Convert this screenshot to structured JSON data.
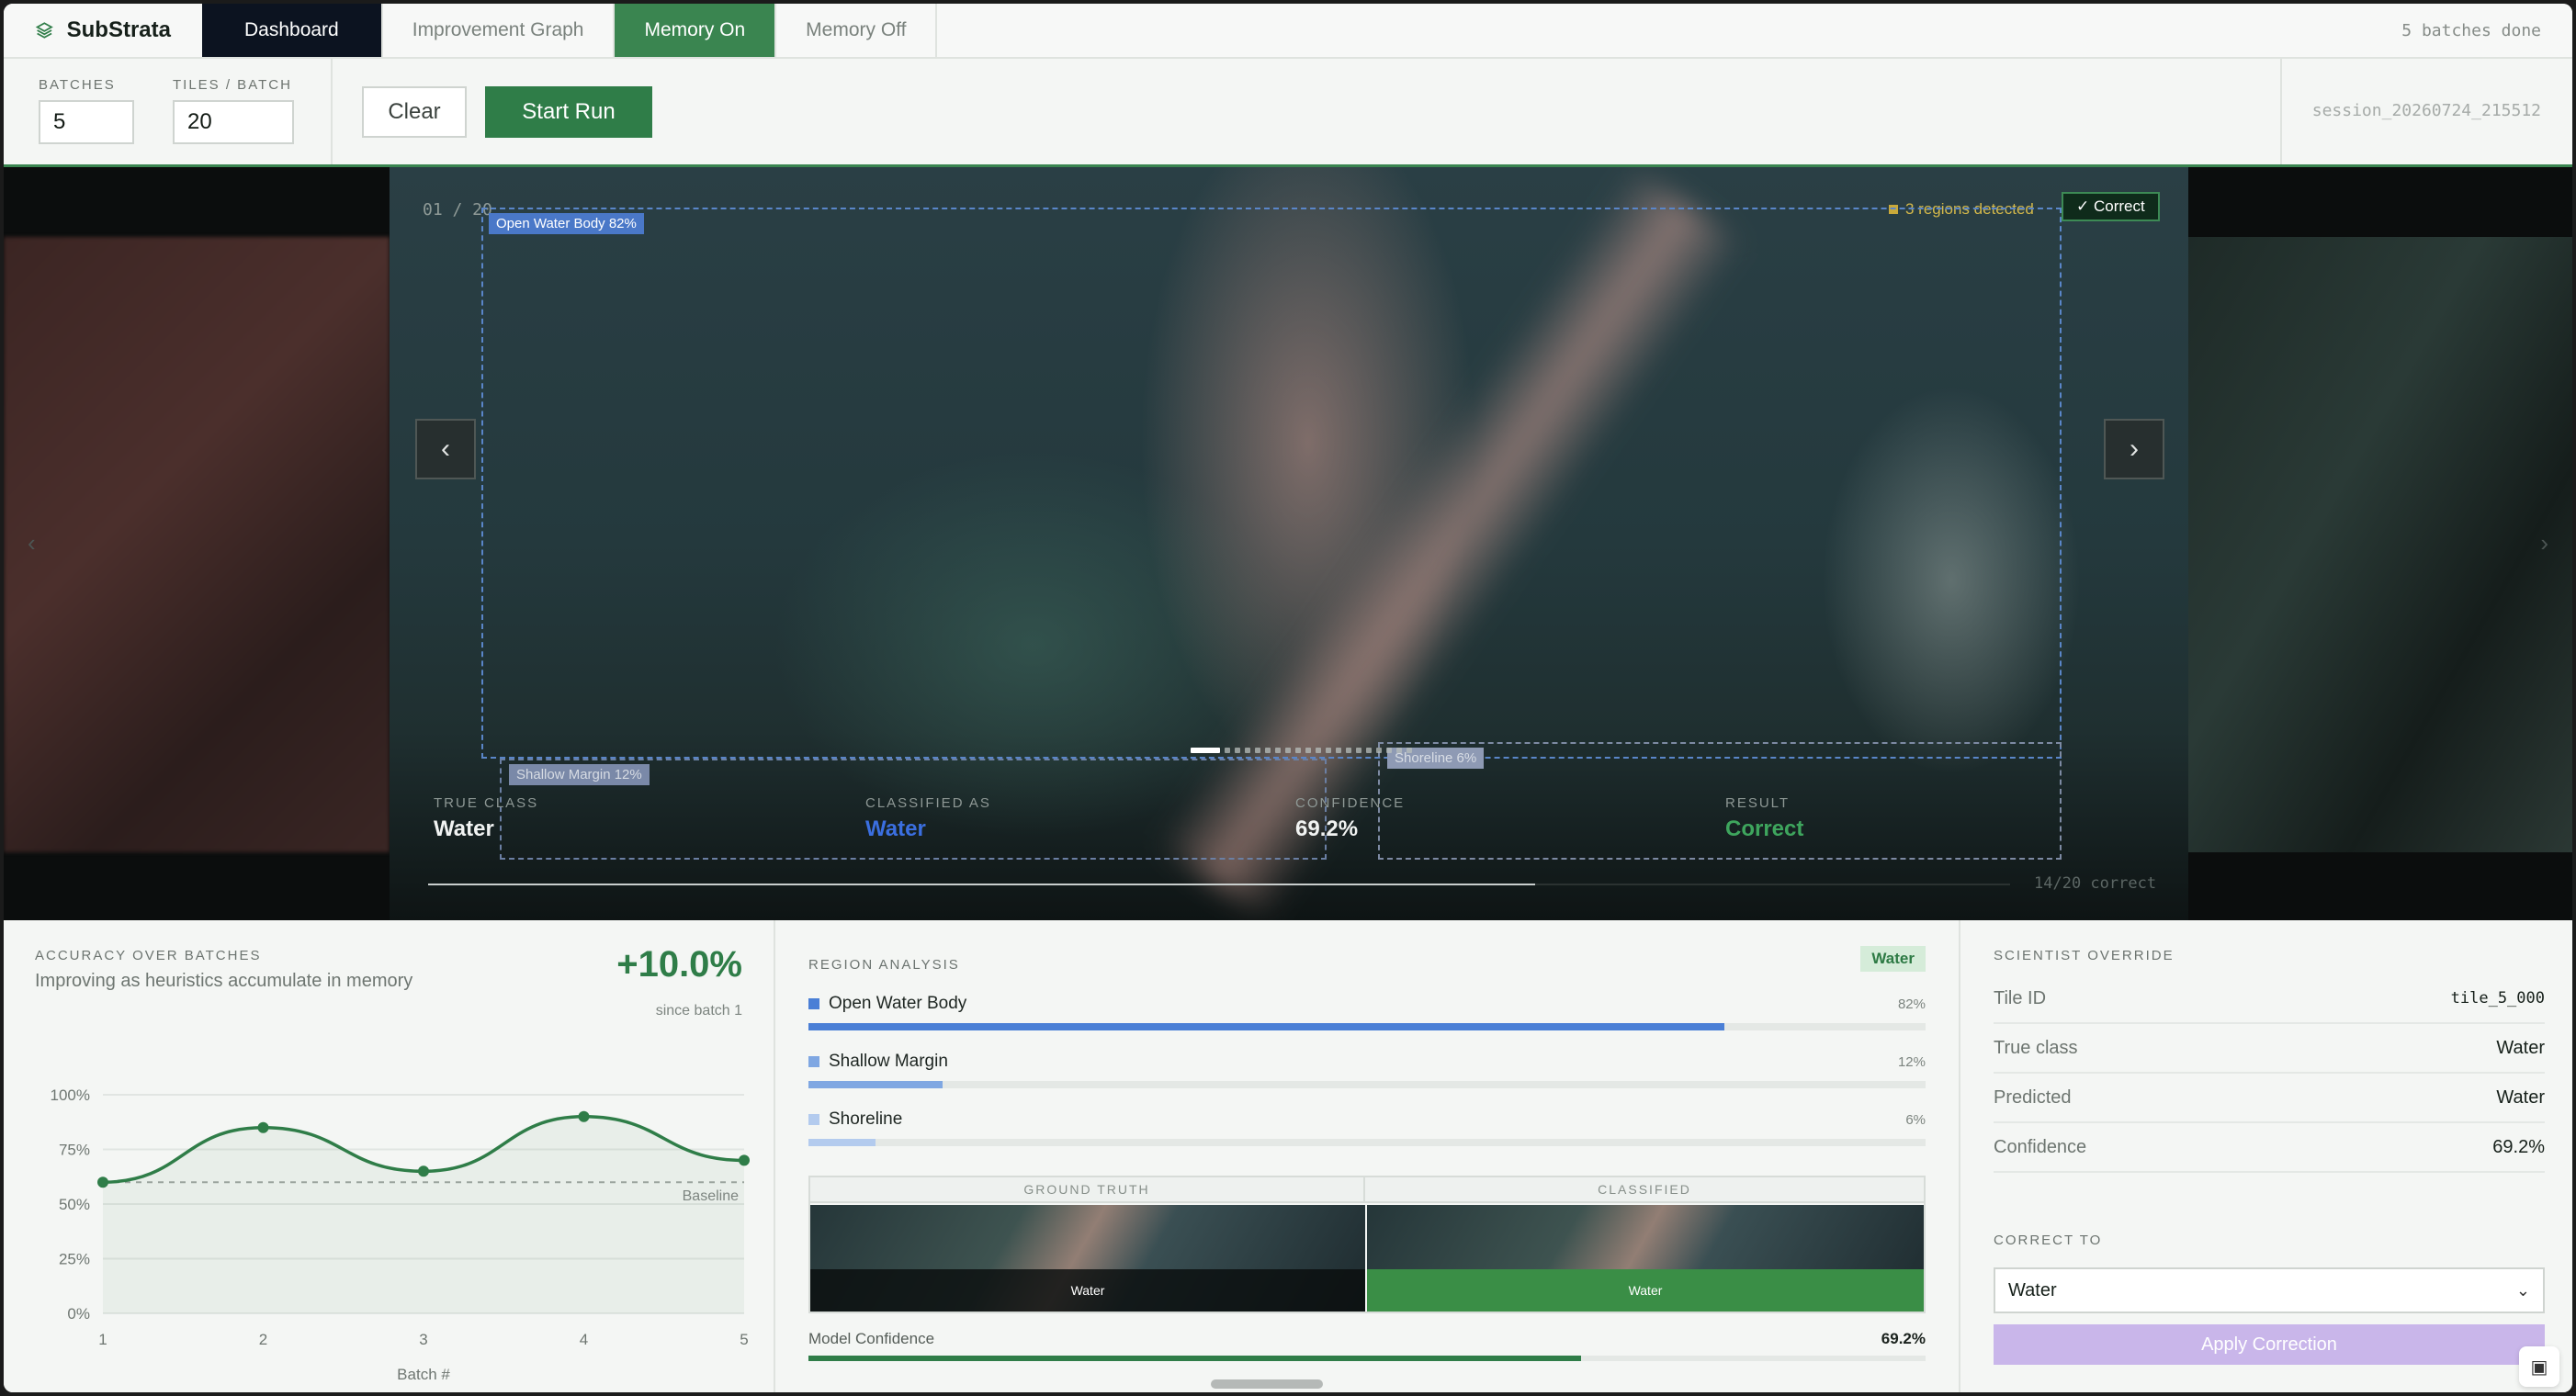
{
  "nav": {
    "brand": "SubStrata",
    "tabs": [
      "Dashboard",
      "Improvement Graph",
      "Memory On",
      "Memory Off"
    ],
    "status": "5 batches done"
  },
  "controls": {
    "batches_label": "BATCHES",
    "batches_value": "5",
    "tiles_label": "TILES / BATCH",
    "tiles_value": "20",
    "clear_label": "Clear",
    "run_label": "Start Run",
    "session": "session_20260724_215512"
  },
  "viewer": {
    "counter": "01 / 20",
    "regions_detected": "3 regions detected",
    "correct_badge": "✓ Correct",
    "box_open_water": "Open Water Body 82%",
    "box_shallow": "Shallow Margin 12%",
    "box_shoreline": "Shoreline 6%",
    "prev_icon": "‹",
    "next_icon": "›",
    "true_class_label": "TRUE CLASS",
    "true_class": "Water",
    "classified_label": "CLASSIFIED AS",
    "classified": "Water",
    "confidence_label": "CONFIDENCE",
    "confidence": "69.2%",
    "result_label": "RESULT",
    "result": "Correct",
    "progress_label": "14/20 correct",
    "progress_fraction": 0.7
  },
  "accuracy": {
    "title": "ACCURACY OVER BATCHES",
    "subtitle": "Improving as heuristics accumulate in memory",
    "delta": "+10.0%",
    "since": "since batch 1",
    "baseline_label": "Baseline",
    "xlabel": "Batch #"
  },
  "chart_data": {
    "type": "line",
    "x": [
      1,
      2,
      3,
      4,
      5
    ],
    "values": [
      60,
      85,
      65,
      90,
      70
    ],
    "baseline": 60,
    "ylim": [
      0,
      100
    ],
    "yticks": [
      "0%",
      "25%",
      "50%",
      "75%",
      "100%"
    ],
    "xlabel": "Batch #",
    "colors": {
      "line": "#2f7d48",
      "baseline": "#9aa39d"
    }
  },
  "region_analysis": {
    "title": "REGION ANALYSIS",
    "badge": "Water",
    "items": [
      {
        "name": "Open Water Body",
        "pct": "82%",
        "value": 0.82,
        "color": "#4a7fd6"
      },
      {
        "name": "Shallow Margin",
        "pct": "12%",
        "value": 0.12,
        "color": "#7fa7e2"
      },
      {
        "name": "Shoreline",
        "pct": "6%",
        "value": 0.06,
        "color": "#b3cbee"
      }
    ],
    "ground_truth_label": "GROUND TRUTH",
    "classified_label": "CLASSIFIED",
    "ground_truth_caption": "Water",
    "classified_caption": "Water",
    "model_confidence_label": "Model Confidence",
    "model_confidence": "69.2%",
    "model_confidence_value": 0.692
  },
  "override": {
    "title": "SCIENTIST OVERRIDE",
    "tile_id_label": "Tile ID",
    "tile_id": "tile_5_000",
    "true_class_label": "True class",
    "true_class": "Water",
    "predicted_label": "Predicted",
    "predicted": "Water",
    "confidence_label": "Confidence",
    "confidence": "69.2%",
    "correct_to_label": "CORRECT TO",
    "correct_to_value": "Water",
    "apply_label": "Apply Correction"
  }
}
